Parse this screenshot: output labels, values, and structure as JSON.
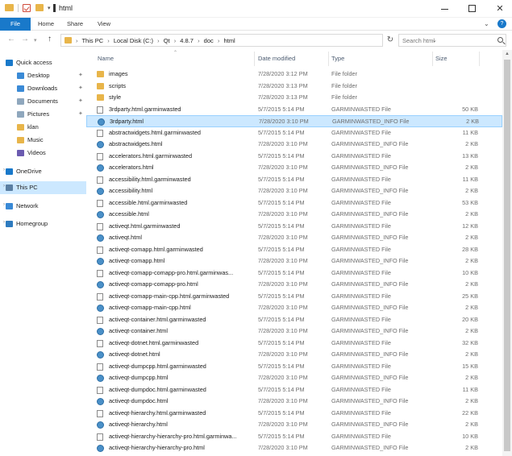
{
  "window": {
    "title": "html",
    "minimize": "—",
    "maximize": "",
    "close": "✕"
  },
  "ribbon": {
    "tabs": [
      "File",
      "Home",
      "Share",
      "View"
    ]
  },
  "address": {
    "crumbs": [
      "This PC",
      "Local Disk (C:)",
      "Qt",
      "4.8.7",
      "doc",
      "html"
    ],
    "search_placeholder": "Search html"
  },
  "navpane": {
    "items": [
      {
        "label": "Quick access",
        "icon": "star-icon",
        "pinned": false
      },
      {
        "label": "Desktop",
        "icon": "desktop-folder-icon",
        "pinned": true
      },
      {
        "label": "Downloads",
        "icon": "downloads-folder-icon",
        "pinned": true
      },
      {
        "label": "Documents",
        "icon": "documents-folder-icon",
        "pinned": true
      },
      {
        "label": "Pictures",
        "icon": "pictures-folder-icon",
        "pinned": true
      },
      {
        "label": "klan",
        "icon": "folder-icon",
        "pinned": false
      },
      {
        "label": "Music",
        "icon": "music-folder-icon",
        "pinned": false
      },
      {
        "label": "Videos",
        "icon": "videos-folder-icon",
        "pinned": false
      },
      {
        "label": "OneDrive",
        "icon": "onedrive-cloud-icon",
        "pinned": false
      },
      {
        "label": "This PC",
        "icon": "computer-icon",
        "pinned": false
      },
      {
        "label": "Network",
        "icon": "network-icon",
        "pinned": false
      },
      {
        "label": "Homegroup",
        "icon": "homegroup-icon",
        "pinned": false
      }
    ]
  },
  "columns": {
    "name": "Name",
    "date": "Date modified",
    "type": "Type",
    "size": "Size"
  },
  "files": [
    {
      "name": "images",
      "date": "7/28/2020 3:12 PM",
      "type": "File folder",
      "size": "",
      "kind": "folder"
    },
    {
      "name": "scripts",
      "date": "7/28/2020 3:13 PM",
      "type": "File folder",
      "size": "",
      "kind": "folder"
    },
    {
      "name": "style",
      "date": "7/28/2020 3:13 PM",
      "type": "File folder",
      "size": "",
      "kind": "folder"
    },
    {
      "name": "3rdparty.html.garminwasted",
      "date": "5/7/2015 5:14 PM",
      "type": "GARMINWASTED File",
      "size": "50 KB",
      "kind": "file"
    },
    {
      "name": "3rdparty.html",
      "date": "7/28/2020 3:10 PM",
      "type": "GARMINWASTED_INFO File",
      "size": "2 KB",
      "kind": "html",
      "selected": true
    },
    {
      "name": "abstractwidgets.html.garminwasted",
      "date": "5/7/2015 5:14 PM",
      "type": "GARMINWASTED File",
      "size": "11 KB",
      "kind": "file"
    },
    {
      "name": "abstractwidgets.html",
      "date": "7/28/2020 3:10 PM",
      "type": "GARMINWASTED_INFO File",
      "size": "2 KB",
      "kind": "html"
    },
    {
      "name": "accelerators.html.garminwasted",
      "date": "5/7/2015 5:14 PM",
      "type": "GARMINWASTED File",
      "size": "13 KB",
      "kind": "file"
    },
    {
      "name": "accelerators.html",
      "date": "7/28/2020 3:10 PM",
      "type": "GARMINWASTED_INFO File",
      "size": "2 KB",
      "kind": "html"
    },
    {
      "name": "accessibility.html.garminwasted",
      "date": "5/7/2015 5:14 PM",
      "type": "GARMINWASTED File",
      "size": "11 KB",
      "kind": "file"
    },
    {
      "name": "accessibility.html",
      "date": "7/28/2020 3:10 PM",
      "type": "GARMINWASTED_INFO File",
      "size": "2 KB",
      "kind": "html"
    },
    {
      "name": "accessible.html.garminwasted",
      "date": "5/7/2015 5:14 PM",
      "type": "GARMINWASTED File",
      "size": "53 KB",
      "kind": "file"
    },
    {
      "name": "accessible.html",
      "date": "7/28/2020 3:10 PM",
      "type": "GARMINWASTED_INFO File",
      "size": "2 KB",
      "kind": "html"
    },
    {
      "name": "activeqt.html.garminwasted",
      "date": "5/7/2015 5:14 PM",
      "type": "GARMINWASTED File",
      "size": "12 KB",
      "kind": "file"
    },
    {
      "name": "activeqt.html",
      "date": "7/28/2020 3:10 PM",
      "type": "GARMINWASTED_INFO File",
      "size": "2 KB",
      "kind": "html"
    },
    {
      "name": "activeqt-comapp.html.garminwasted",
      "date": "5/7/2015 5:14 PM",
      "type": "GARMINWASTED File",
      "size": "28 KB",
      "kind": "file"
    },
    {
      "name": "activeqt-comapp.html",
      "date": "7/28/2020 3:10 PM",
      "type": "GARMINWASTED_INFO File",
      "size": "2 KB",
      "kind": "html"
    },
    {
      "name": "activeqt-comapp-comapp-pro.html.garminwas...",
      "date": "5/7/2015 5:14 PM",
      "type": "GARMINWASTED File",
      "size": "10 KB",
      "kind": "file"
    },
    {
      "name": "activeqt-comapp-comapp-pro.html",
      "date": "7/28/2020 3:10 PM",
      "type": "GARMINWASTED_INFO File",
      "size": "2 KB",
      "kind": "html"
    },
    {
      "name": "activeqt-comapp-main-cpp.html.garminwasted",
      "date": "5/7/2015 5:14 PM",
      "type": "GARMINWASTED File",
      "size": "25 KB",
      "kind": "file"
    },
    {
      "name": "activeqt-comapp-main-cpp.html",
      "date": "7/28/2020 3:10 PM",
      "type": "GARMINWASTED_INFO File",
      "size": "2 KB",
      "kind": "html"
    },
    {
      "name": "activeqt-container.html.garminwasted",
      "date": "5/7/2015 5:14 PM",
      "type": "GARMINWASTED File",
      "size": "20 KB",
      "kind": "file"
    },
    {
      "name": "activeqt-container.html",
      "date": "7/28/2020 3:10 PM",
      "type": "GARMINWASTED_INFO File",
      "size": "2 KB",
      "kind": "html"
    },
    {
      "name": "activeqt-dotnet.html.garminwasted",
      "date": "5/7/2015 5:14 PM",
      "type": "GARMINWASTED File",
      "size": "32 KB",
      "kind": "file"
    },
    {
      "name": "activeqt-dotnet.html",
      "date": "7/28/2020 3:10 PM",
      "type": "GARMINWASTED_INFO File",
      "size": "2 KB",
      "kind": "html"
    },
    {
      "name": "activeqt-dumpcpp.html.garminwasted",
      "date": "5/7/2015 5:14 PM",
      "type": "GARMINWASTED File",
      "size": "15 KB",
      "kind": "file"
    },
    {
      "name": "activeqt-dumpcpp.html",
      "date": "7/28/2020 3:10 PM",
      "type": "GARMINWASTED_INFO File",
      "size": "2 KB",
      "kind": "html"
    },
    {
      "name": "activeqt-dumpdoc.html.garminwasted",
      "date": "5/7/2015 5:14 PM",
      "type": "GARMINWASTED File",
      "size": "11 KB",
      "kind": "file"
    },
    {
      "name": "activeqt-dumpdoc.html",
      "date": "7/28/2020 3:10 PM",
      "type": "GARMINWASTED_INFO File",
      "size": "2 KB",
      "kind": "html"
    },
    {
      "name": "activeqt-hierarchy.html.garminwasted",
      "date": "5/7/2015 5:14 PM",
      "type": "GARMINWASTED File",
      "size": "22 KB",
      "kind": "file"
    },
    {
      "name": "activeqt-hierarchy.html",
      "date": "7/28/2020 3:10 PM",
      "type": "GARMINWASTED_INFO File",
      "size": "2 KB",
      "kind": "html"
    },
    {
      "name": "activeqt-hierarchy-hierarchy-pro.html.garminwa...",
      "date": "5/7/2015 5:14 PM",
      "type": "GARMINWASTED File",
      "size": "10 KB",
      "kind": "file"
    },
    {
      "name": "activeqt-hierarchy-hierarchy-pro.html",
      "date": "7/28/2020 3:10 PM",
      "type": "GARMINWASTED_INFO File",
      "size": "2 KB",
      "kind": "html"
    }
  ]
}
